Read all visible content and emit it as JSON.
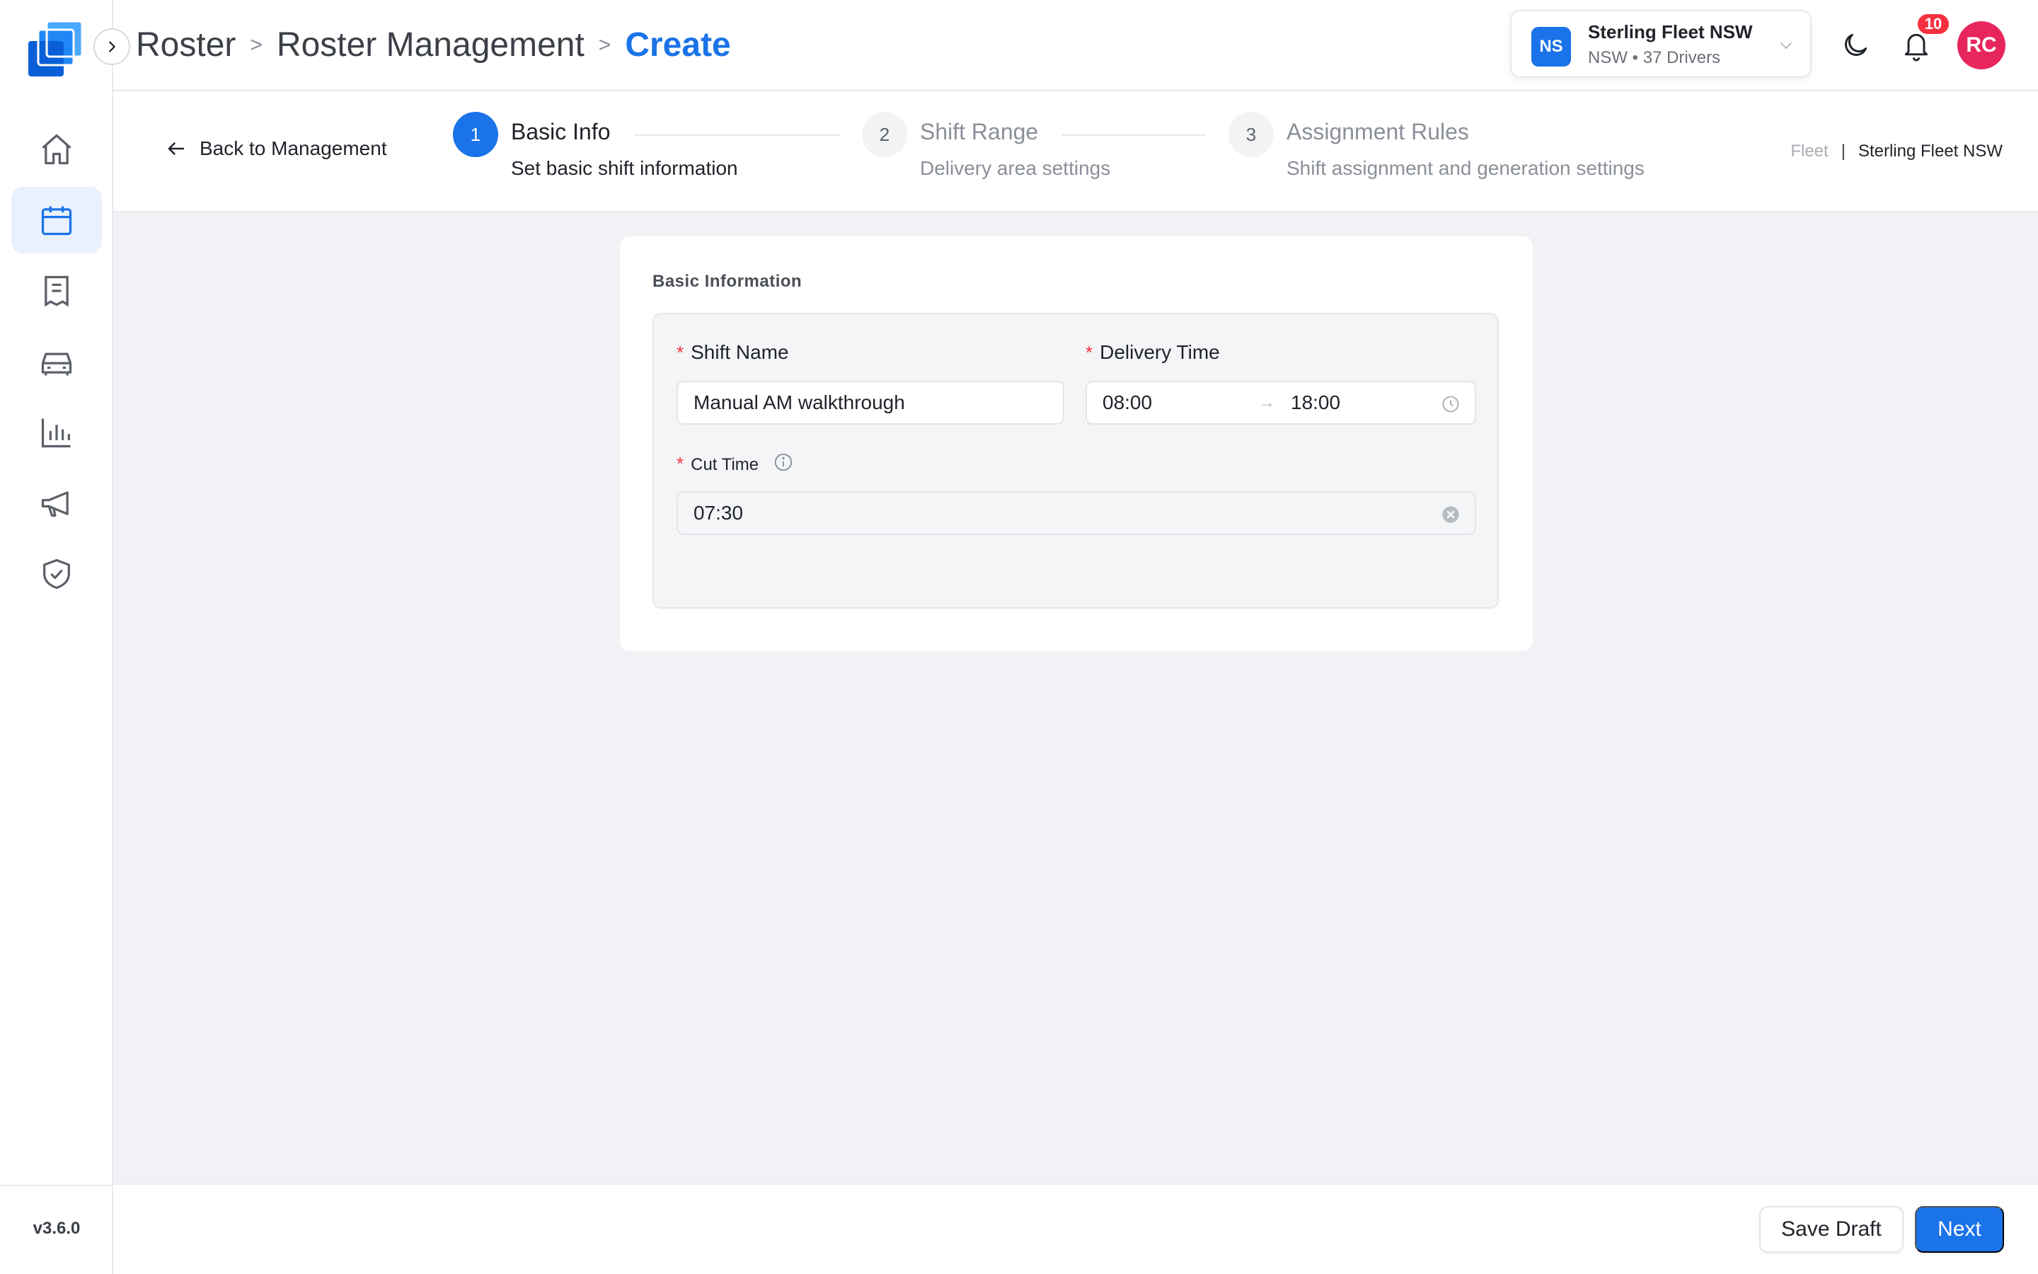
{
  "app": {
    "logo_icon": "stacked-squares-logo",
    "version": "v3.6.0",
    "colors": {
      "accent": "#1a73e8",
      "required": "#f5313f",
      "avatar": "#e8265e"
    }
  },
  "sidebar": {
    "expand_icon": "chevron-right-icon",
    "items": [
      {
        "name": "home",
        "icon": "home-icon",
        "active": false
      },
      {
        "name": "roster",
        "icon": "calendar-icon",
        "active": true
      },
      {
        "name": "orders",
        "icon": "document-list-icon",
        "active": false
      },
      {
        "name": "vehicles",
        "icon": "car-icon",
        "active": false
      },
      {
        "name": "reports",
        "icon": "bar-chart-icon",
        "active": false
      },
      {
        "name": "announcements",
        "icon": "megaphone-icon",
        "active": false
      },
      {
        "name": "compliance",
        "icon": "shield-check-icon",
        "active": false
      }
    ]
  },
  "header": {
    "breadcrumb": [
      "Roster",
      "Roster Management",
      "Create"
    ],
    "breadcrumb_sep": ">",
    "fleet": {
      "initials": "NS",
      "name": "Sterling Fleet NSW",
      "sub": "NSW • 37 Drivers"
    },
    "notifications": "10",
    "user_initials": "RC"
  },
  "steps": {
    "back_label": "Back to Management",
    "items": [
      {
        "num": "1",
        "title": "Basic Info",
        "desc": "Set basic shift information"
      },
      {
        "num": "2",
        "title": "Shift Range",
        "desc": "Delivery area settings"
      },
      {
        "num": "3",
        "title": "Assignment Rules",
        "desc": "Shift assignment and generation settings"
      }
    ],
    "fleet_label": "Fleet",
    "fleet_sep": "|",
    "fleet_value": "Sterling Fleet NSW"
  },
  "form": {
    "section_title": "Basic Information",
    "required_mark": "*",
    "shift_name": {
      "label": "Shift Name",
      "value": "Manual AM walkthrough"
    },
    "delivery_time": {
      "label": "Delivery Time",
      "start": "08:00",
      "end": "18:00",
      "arrow": "→"
    },
    "cut_time": {
      "label": "Cut Time",
      "value": "07:30"
    }
  },
  "footer": {
    "save_draft": "Save Draft",
    "next": "Next"
  }
}
